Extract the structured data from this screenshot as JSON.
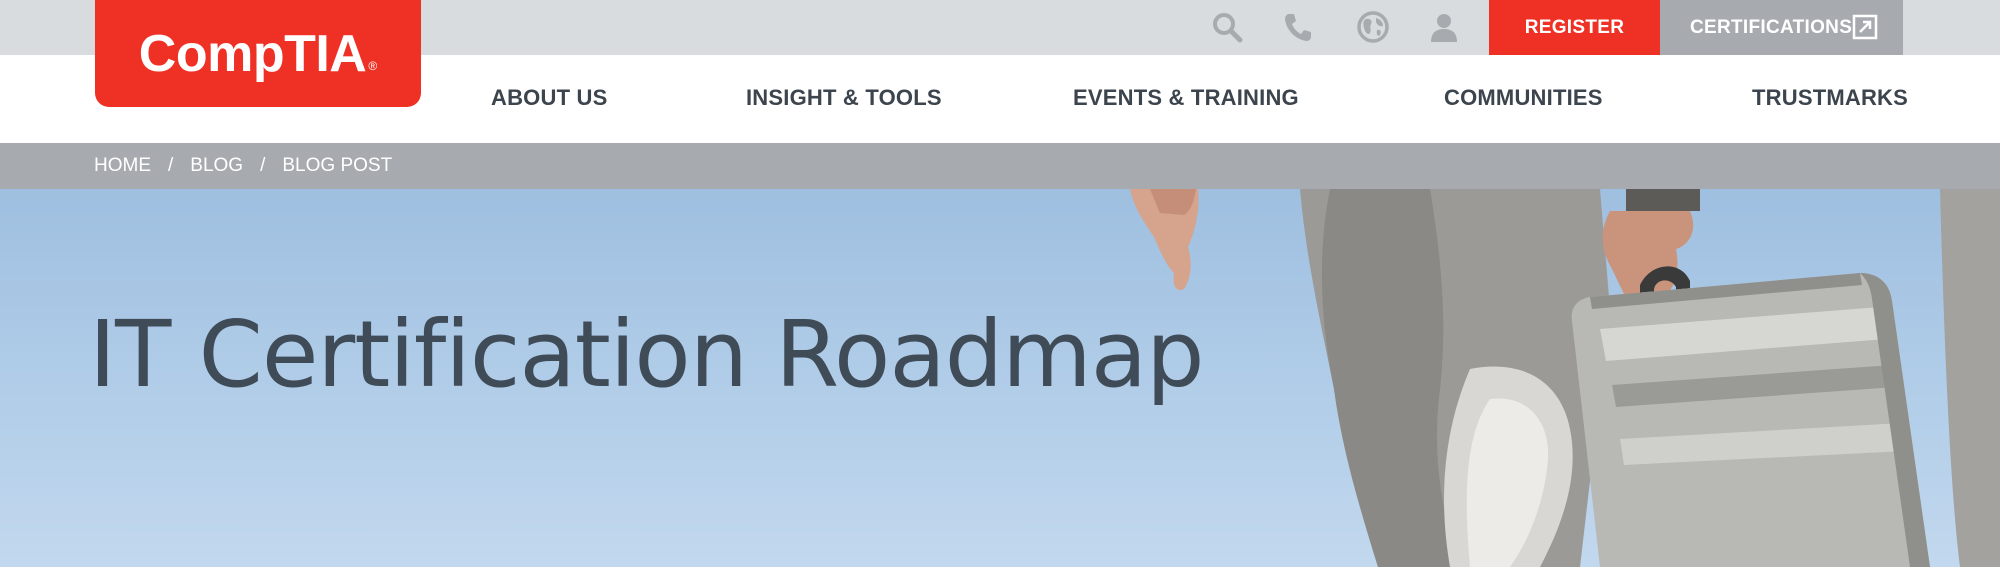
{
  "logo": {
    "text": "CompTIA",
    "reg_mark": "®"
  },
  "utility": {
    "icons": [
      "search-icon",
      "phone-icon",
      "globe-icon",
      "user-icon"
    ],
    "register_label": "REGISTER",
    "certifications_label": "CERTIFICATIONS"
  },
  "nav": {
    "items": [
      {
        "label": "ABOUT US"
      },
      {
        "label": "INSIGHT & TOOLS"
      },
      {
        "label": "EVENTS & TRAINING"
      },
      {
        "label": "COMMUNITIES"
      },
      {
        "label": "TRUSTMARKS"
      }
    ]
  },
  "breadcrumb": {
    "items": [
      {
        "label": "HOME"
      },
      {
        "label": "BLOG"
      },
      {
        "label": "BLOG POST"
      }
    ],
    "separator": "/"
  },
  "hero": {
    "title": "IT Certification Roadmap"
  },
  "colors": {
    "brand_red": "#ee3124",
    "utility_bg": "#d9dcdf",
    "breadcrumb_bg": "#a7abb0",
    "nav_text": "#3c444d",
    "hero_title": "#3f4b57",
    "sky": "#aecbe7"
  }
}
